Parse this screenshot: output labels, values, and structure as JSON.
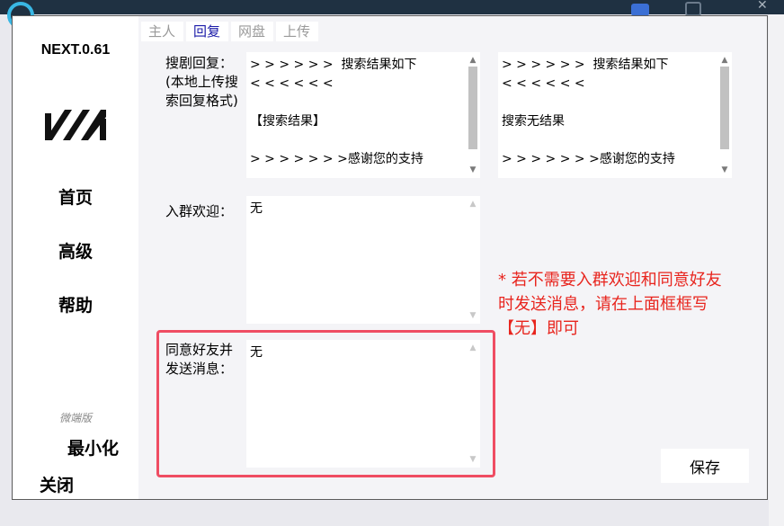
{
  "app": {
    "version": "NEXT.0.61",
    "edition": "微端版"
  },
  "sidebar": {
    "items": [
      {
        "label": "首页"
      },
      {
        "label": "高级"
      },
      {
        "label": "帮助"
      }
    ],
    "minimize_label": "最小化",
    "close_label": "关闭"
  },
  "tabs": [
    {
      "label": "主人",
      "active": false
    },
    {
      "label": "回复",
      "active": true
    },
    {
      "label": "网盘",
      "active": false
    },
    {
      "label": "上传",
      "active": false
    }
  ],
  "reply": {
    "search_reply": {
      "label": "搜剧回复：(本地上传搜索回复格式)",
      "found_value": "> > > > > >  搜索结果如下\n< < < < < <\n\n【搜索结果】\n\n> > > > > > >感谢您的支持",
      "not_found_value": "> > > > > >  搜索结果如下\n< < < < < <\n\n搜索无结果\n\n> > > > > > >感谢您的支持"
    },
    "group_welcome": {
      "label": "入群欢迎：",
      "value": "无"
    },
    "friend_accept": {
      "label": "同意好友并发送消息：",
      "value": "无"
    },
    "note": "* 若不需要入群欢迎和同意好友时发送消息，请在上面框框写【无】即可",
    "save_label": "保存"
  },
  "colors": {
    "accent_tab": "#1a1aa8",
    "note": "#e8251e",
    "highlight": "#ef4d63"
  }
}
